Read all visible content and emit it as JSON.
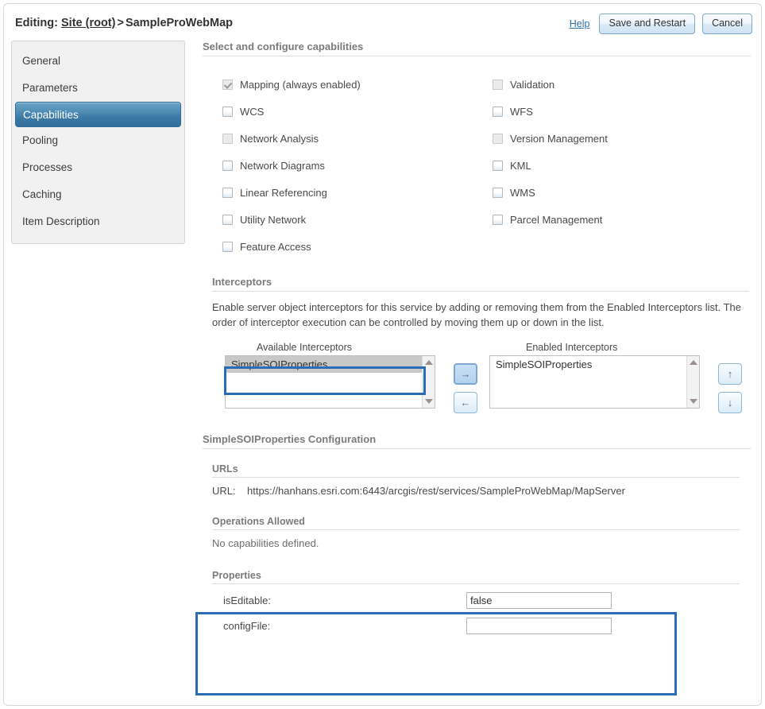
{
  "header": {
    "editing_label": "Editing:",
    "breadcrumb_root": "Site (root)",
    "breadcrumb_sep": ">",
    "service_name": "SampleProWebMap",
    "help_label": "Help",
    "save_label": "Save and Restart",
    "cancel_label": "Cancel"
  },
  "sidebar": {
    "items": [
      {
        "label": "General",
        "selected": false
      },
      {
        "label": "Parameters",
        "selected": false
      },
      {
        "label": "Capabilities",
        "selected": true
      },
      {
        "label": "Pooling",
        "selected": false
      },
      {
        "label": "Processes",
        "selected": false
      },
      {
        "label": "Caching",
        "selected": false
      },
      {
        "label": "Item Description",
        "selected": false
      }
    ]
  },
  "capabilities": {
    "section_title": "Select and configure capabilities",
    "left_column": [
      {
        "label": "Mapping (always enabled)",
        "checked": true,
        "disabled": true
      },
      {
        "label": "WCS",
        "checked": false,
        "disabled": false
      },
      {
        "label": "Network Analysis",
        "checked": false,
        "disabled": true
      },
      {
        "label": "Network Diagrams",
        "checked": false,
        "disabled": false
      },
      {
        "label": "Linear Referencing",
        "checked": false,
        "disabled": false
      },
      {
        "label": "Utility Network",
        "checked": false,
        "disabled": false
      },
      {
        "label": "Feature Access",
        "checked": false,
        "disabled": false
      }
    ],
    "right_column": [
      {
        "label": "Validation",
        "checked": false,
        "disabled": true
      },
      {
        "label": "WFS",
        "checked": false,
        "disabled": false
      },
      {
        "label": "Version Management",
        "checked": false,
        "disabled": true
      },
      {
        "label": "KML",
        "checked": false,
        "disabled": false
      },
      {
        "label": "WMS",
        "checked": false,
        "disabled": false
      },
      {
        "label": "Parcel Management",
        "checked": false,
        "disabled": false
      }
    ]
  },
  "interceptors": {
    "section_title": "Interceptors",
    "description": "Enable server object interceptors for this service by adding or removing them from the Enabled Interceptors list. The order of interceptor execution can be controlled by moving them up or down in the list.",
    "available_title": "Available Interceptors",
    "enabled_title": "Enabled Interceptors",
    "available_items": [
      "SimpleSOIProperties"
    ],
    "enabled_items": [
      "SimpleSOIProperties"
    ],
    "add_glyph": "→",
    "remove_glyph": "←",
    "move_up_glyph": "↑",
    "move_down_glyph": "↓"
  },
  "soi_config": {
    "section_title": "SimpleSOIProperties Configuration",
    "urls_title": "URLs",
    "url_key": "URL:",
    "url_value": "https://hanhans.esri.com:6443/arcgis/rest/services/SampleProWebMap/MapServer",
    "operations_title": "Operations Allowed",
    "operations_value": "No capabilities defined.",
    "properties_title": "Properties",
    "properties": [
      {
        "key": "isEditable:",
        "value": "false"
      },
      {
        "key": "configFile:",
        "value": ""
      }
    ]
  },
  "colors": {
    "accent_blue": "#2b6cb8",
    "selected_nav": "#3c7ba6",
    "link": "#2c6ea8"
  }
}
